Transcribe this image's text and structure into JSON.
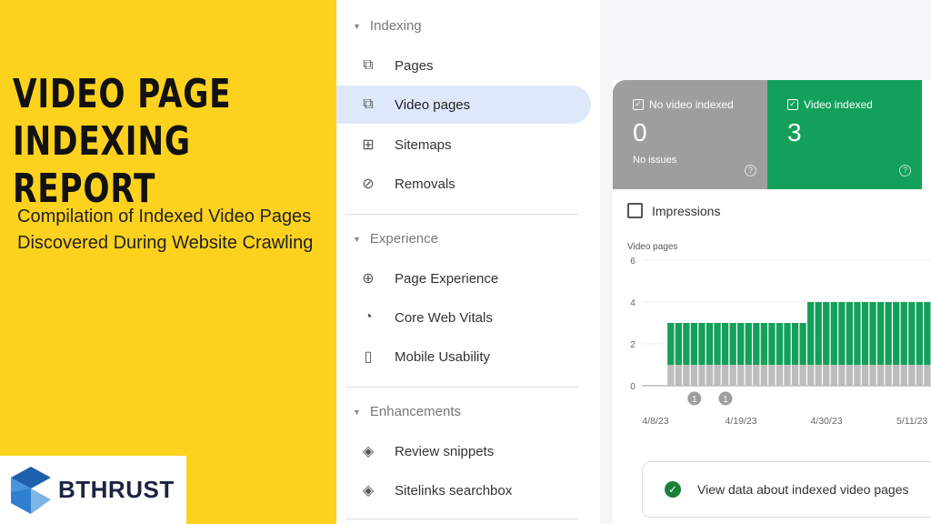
{
  "banner": {
    "title_line1": "VIDEO PAGE",
    "title_line2": "INDEXING REPORT",
    "subtitle": "Compilation of Indexed Video Pages Discovered During Website Crawling",
    "logo_text": "BTHRUST"
  },
  "sidebar": {
    "sections": [
      {
        "label": "Indexing",
        "items": [
          {
            "label": "Pages",
            "icon": "pages-icon"
          },
          {
            "label": "Video pages",
            "icon": "video-pages-icon",
            "active": true
          },
          {
            "label": "Sitemaps",
            "icon": "sitemap-icon"
          },
          {
            "label": "Removals",
            "icon": "eye-off-icon"
          }
        ]
      },
      {
        "label": "Experience",
        "items": [
          {
            "label": "Page Experience",
            "icon": "plus-circle-icon"
          },
          {
            "label": "Core Web Vitals",
            "icon": "gauge-icon"
          },
          {
            "label": "Mobile Usability",
            "icon": "phone-icon"
          }
        ]
      },
      {
        "label": "Enhancements",
        "items": [
          {
            "label": "Review snippets",
            "icon": "layers-icon"
          },
          {
            "label": "Sitelinks searchbox",
            "icon": "layers-icon"
          }
        ]
      }
    ]
  },
  "cards": [
    {
      "label": "No video indexed",
      "value": "0",
      "sub": "No issues",
      "color": "#9e9e9e",
      "checked": true
    },
    {
      "label": "Video indexed",
      "value": "3",
      "sub": "",
      "color": "#13a05a",
      "checked": true
    }
  ],
  "impressions_label": "Impressions",
  "view_data_label": "View data about indexed video pages",
  "chart_data": {
    "type": "bar",
    "stacked": true,
    "ylabel": "Video pages",
    "ylim": [
      0,
      6
    ],
    "yticks": [
      "0",
      "2",
      "4",
      "6"
    ],
    "xticks": [
      "4/8/23",
      "4/19/23",
      "4/30/23",
      "5/11/23"
    ],
    "start_date": "4/10/23",
    "series": [
      {
        "color": "#bdbdbd",
        "values": [
          1,
          1,
          1,
          1,
          1,
          1,
          1,
          1,
          1,
          1,
          1,
          1,
          1,
          1,
          1,
          1,
          1,
          1,
          1,
          1,
          1,
          1,
          1,
          1,
          1,
          1,
          1,
          1,
          1,
          1,
          1,
          1,
          1,
          1
        ]
      },
      {
        "color": "#13a05a",
        "values": [
          2,
          2,
          2,
          2,
          2,
          2,
          2,
          2,
          2,
          2,
          2,
          2,
          2,
          2,
          2,
          2,
          2,
          2,
          3,
          3,
          3,
          3,
          3,
          3,
          3,
          3,
          3,
          3,
          3,
          3,
          3,
          3,
          3,
          3
        ]
      }
    ],
    "annotations": [
      {
        "date": "4/13/23",
        "label": "1"
      },
      {
        "date": "4/17/23",
        "label": "1"
      }
    ]
  }
}
